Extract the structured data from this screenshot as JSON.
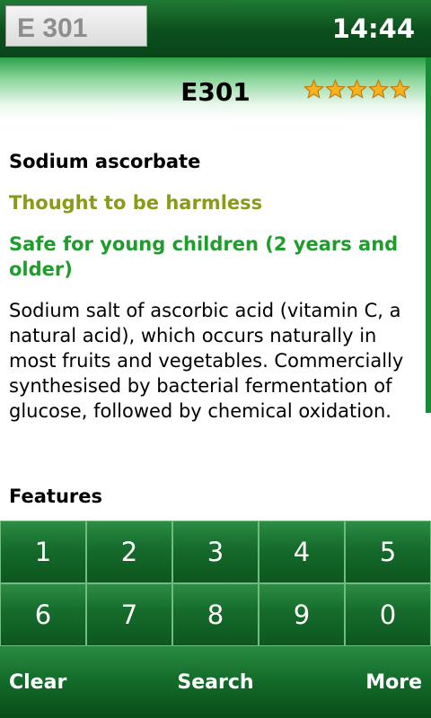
{
  "statusbar": {
    "search_value": "E 301",
    "time": "14:44"
  },
  "header": {
    "code": "E301",
    "rating_stars": 5
  },
  "content": {
    "name": "Sodium ascorbate",
    "rating_text": "Thought to be harmless",
    "safety_text": "Safe for young children (2 years and older)",
    "description": "Sodium salt of ascorbic acid (vitamin C, a natural acid), which occurs naturally in most fruits and vegetables. Commercially synthesised by bacterial fermentation of glucose, followed by chemical oxidation.",
    "features_heading": "Features"
  },
  "keypad": {
    "keys": [
      "1",
      "2",
      "3",
      "4",
      "5",
      "6",
      "7",
      "8",
      "9",
      "0"
    ]
  },
  "softkeys": {
    "left": "Clear",
    "center": "Search",
    "right": "More"
  },
  "colors": {
    "accent_green": "#0b4f1c",
    "rating_color": "#8a9a1a",
    "safety_color": "#1f9d2c",
    "star_fill": "#f7b21f"
  }
}
